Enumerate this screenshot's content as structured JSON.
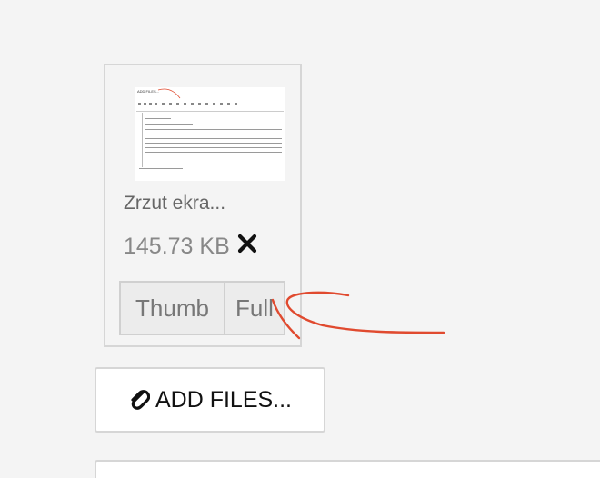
{
  "file": {
    "name": "Zrzut ekra...",
    "size": "145.73 KB",
    "remove_icon": "close-icon",
    "thumbnail": {
      "mini_title": "ADD FILES..."
    }
  },
  "size_buttons": {
    "thumb_label": "Thumb",
    "full_label": "Full"
  },
  "add_files": {
    "label": "ADD FILES...",
    "icon": "paperclip-icon"
  },
  "colors": {
    "annotation": "#e04a2f",
    "background": "#f4f4f4",
    "border": "#d6d6d6"
  }
}
